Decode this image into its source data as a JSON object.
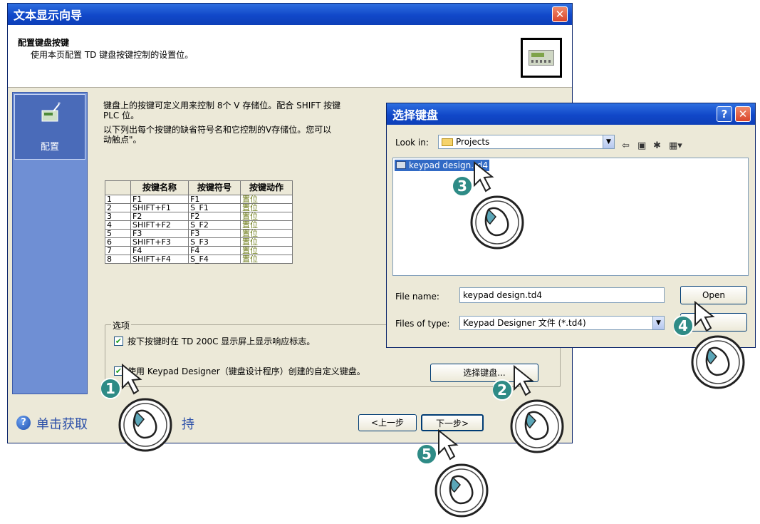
{
  "main_window": {
    "title": "文本显示向导",
    "page_title": "配置键盘按键",
    "page_subtitle": "使用本页配置 TD 键盘按键控制的设置位。",
    "sidebar_item": "配置",
    "paragraph1_line1": "键盘上的按键可定义用来控制 8个 V 存储位。配合 SHIFT 按键",
    "paragraph1_line2": "PLC 位。",
    "paragraph2_line1": "以下列出每个按键的缺省符号名和它控制的V存储位。您可以",
    "paragraph2_line2": "动触点\"。",
    "table": {
      "headers": [
        "",
        "按键名称",
        "按键符号",
        "按键动作"
      ],
      "rows": [
        [
          "1",
          "F1",
          "F1",
          "置位"
        ],
        [
          "2",
          "SHIFT+F1",
          "S_F1",
          "置位"
        ],
        [
          "3",
          "F2",
          "F2",
          "置位"
        ],
        [
          "4",
          "SHIFT+F2",
          "S_F2",
          "置位"
        ],
        [
          "5",
          "F3",
          "F3",
          "置位"
        ],
        [
          "6",
          "SHIFT+F3",
          "S_F3",
          "置位"
        ],
        [
          "7",
          "F4",
          "F4",
          "置位"
        ],
        [
          "8",
          "SHIFT+F4",
          "S_F4",
          "置位"
        ]
      ]
    },
    "options_legend": "选项",
    "option1": "按下按键时在 TD 200C 显示屏上显示响应标志。",
    "option2": "使用 Keypad Designer（键盘设计程序）创建的自定义键盘。",
    "select_keypad_button": "选择键盘...",
    "help_text": "单击获取",
    "help_text_tail": "持",
    "prev_button": "<上一步",
    "next_button": "下一步>"
  },
  "dialog": {
    "title": "选择键盘",
    "look_in_label": "Look in:",
    "look_in_value": "Projects",
    "file_item": "keypad design.td4",
    "file_name_label": "File name:",
    "file_name_value": "keypad design.td4",
    "files_of_type_label": "Files of type:",
    "files_of_type_value": "Keypad Designer 文件 (*.td4)",
    "open_button": "Open",
    "help_button": "?",
    "close_button": "✕"
  },
  "steps": [
    "1",
    "2",
    "3",
    "4",
    "5"
  ],
  "colors": {
    "titlebar": "#1148c9",
    "sidebar": "#6f8fd4",
    "selection": "#316ac5",
    "step_badge": "#2e8b86"
  }
}
